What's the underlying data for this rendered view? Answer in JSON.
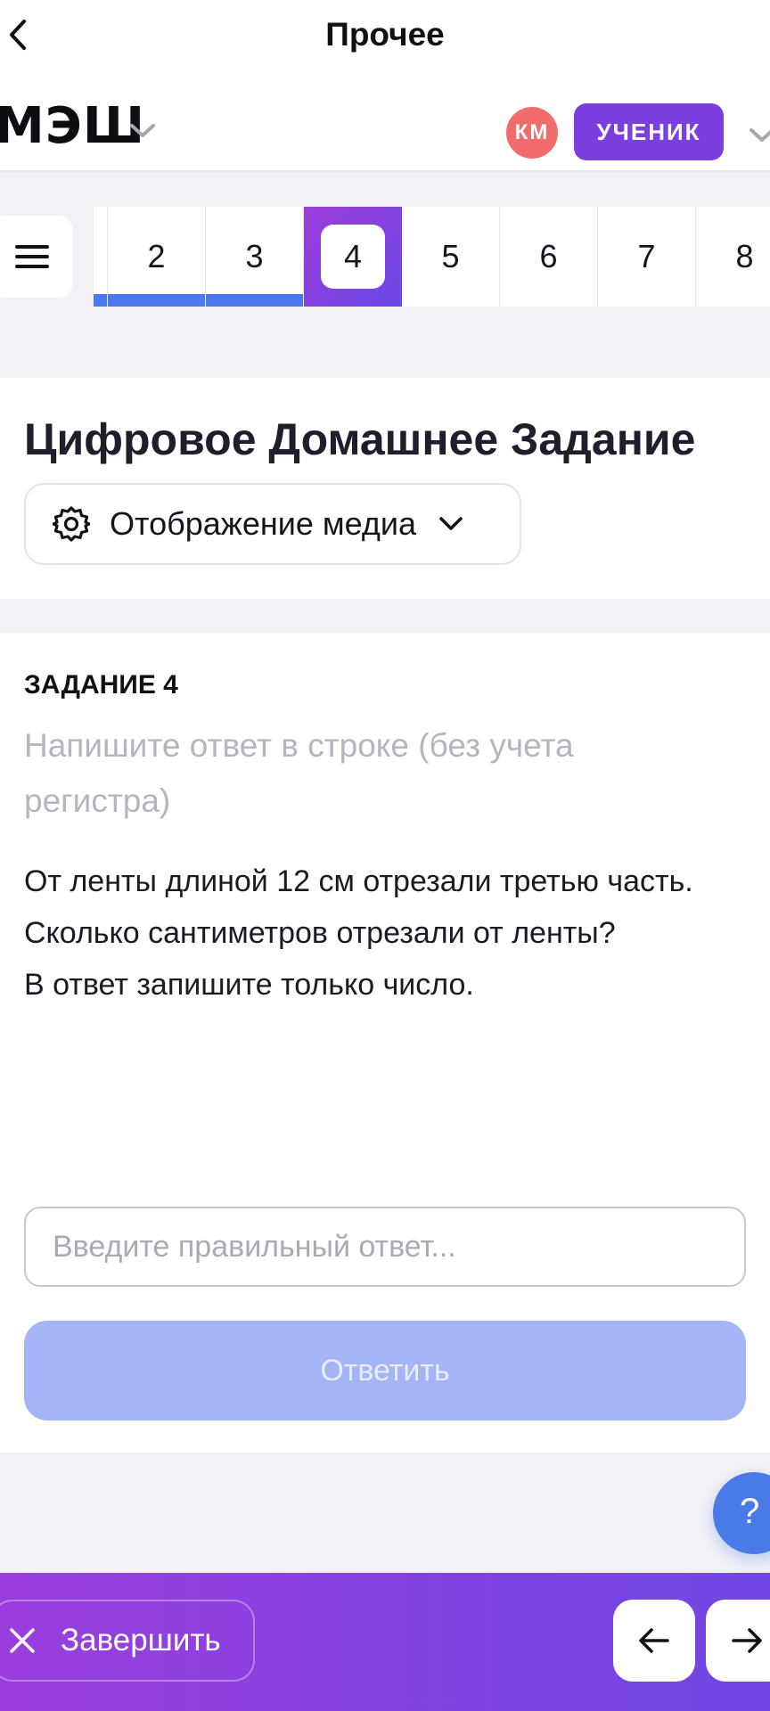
{
  "topnav": {
    "title": "Прочее",
    "back_icon": "chevron-left-icon"
  },
  "header": {
    "brand": "МЭШ",
    "avatar_initials": "КМ",
    "role": "УЧЕНИК",
    "colors": {
      "avatar": "#f26c6c",
      "role_badge": "#7b3fe0"
    }
  },
  "task_strip": {
    "menu_icon": "hamburger-menu-icon",
    "items": [
      {
        "label": "",
        "status": "done"
      },
      {
        "label": "2",
        "status": "done"
      },
      {
        "label": "3",
        "status": "done"
      },
      {
        "label": "4",
        "status": "current"
      },
      {
        "label": "5",
        "status": "pending"
      },
      {
        "label": "6",
        "status": "pending"
      },
      {
        "label": "7",
        "status": "pending"
      },
      {
        "label": "8",
        "status": "pending"
      }
    ],
    "colors": {
      "done": "#4b78f0",
      "current": "#8a42e0"
    }
  },
  "page": {
    "title": "Цифровое Домашнее Задание",
    "media_select_label": "Отображение медиа"
  },
  "task": {
    "heading": "ЗАДАНИЕ 4",
    "hint": "Напишите ответ в строке (без учета регистра)",
    "body_lines": [
      "От ленты длиной 12 см отрезали третью часть. Сколько сантиметров отрезали от ленты?",
      "В ответ запишите только число."
    ],
    "answer_placeholder": "Введите правильный ответ...",
    "answer_value": "",
    "submit_label": "Ответить"
  },
  "help": {
    "label": "?"
  },
  "bottom_bar": {
    "finish_label": "Завершить",
    "prev_icon": "arrow-left-icon",
    "next_icon": "arrow-right-icon"
  }
}
